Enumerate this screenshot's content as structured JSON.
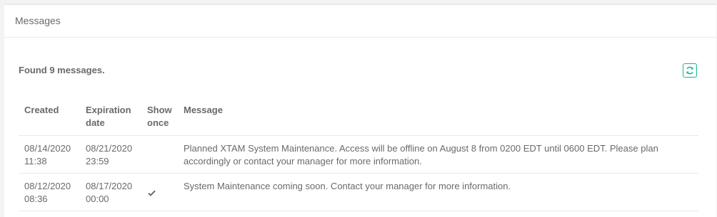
{
  "panel": {
    "title": "Messages"
  },
  "summary": {
    "found_text": "Found 9 messages."
  },
  "toolbar": {
    "refresh_icon": "refresh-icon",
    "accent_color": "#1ab394"
  },
  "table": {
    "columns": {
      "created": "Created",
      "expiration_line1": "Expiration",
      "expiration_line2": "date",
      "show_once_line1": "Show",
      "show_once_line2": "once",
      "message": "Message"
    },
    "rows": [
      {
        "created_date": "08/14/2020",
        "created_time": "11:38",
        "expiration_date": "08/21/2020",
        "expiration_time": "23:59",
        "show_once": false,
        "message": "Planned XTAM System Maintenance. Access will be offline on August 8 from 0200 EDT until 0600 EDT. Please plan accordingly or contact your manager for more information."
      },
      {
        "created_date": "08/12/2020",
        "created_time": "08:36",
        "expiration_date": "08/17/2020",
        "expiration_time": "00:00",
        "show_once": true,
        "message": "System Maintenance coming soon. Contact your manager for more information."
      }
    ]
  }
}
